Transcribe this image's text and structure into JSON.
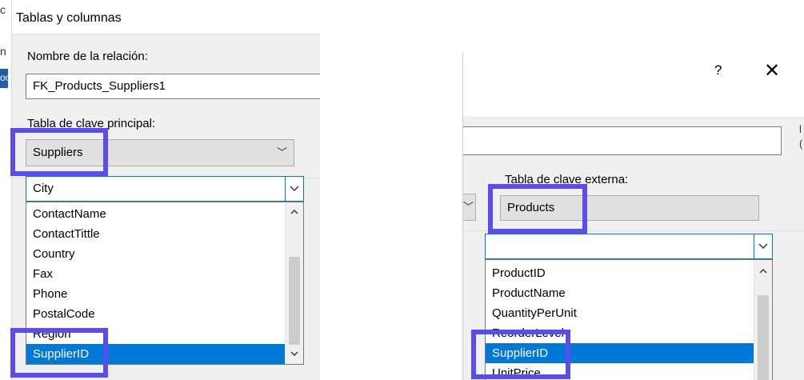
{
  "left_dialog": {
    "title": "Tablas y columnas",
    "edge_fragments": [
      "c",
      "n",
      "oc"
    ],
    "relation_label": "Nombre de la relación:",
    "relation_value": "FK_Products_Suppliers1",
    "primary_table_label": "Tabla de clave principal:",
    "primary_table_value": "Suppliers",
    "column_combo_value": "City",
    "column_list": [
      "ContactName",
      "ContactTittle",
      "Country",
      "Fax",
      "Phone",
      "PostalCode",
      "Region",
      "SupplierID"
    ],
    "selected_item": "SupplierID"
  },
  "right_dialog": {
    "help_glyph": "?",
    "close_glyph": "✕",
    "foreign_table_label": "Tabla de clave externa:",
    "foreign_table_value": "Products",
    "column_combo_value": "",
    "column_list": [
      "ProductID",
      "ProductName",
      "QuantityPerUnit",
      "ReorderLevel",
      "SupplierID",
      "UnitPrice"
    ],
    "selected_item": "SupplierID"
  },
  "colors": {
    "highlight": "#5a4df0",
    "selection": "#0078d7",
    "dialog_bg": "#f0f0f0"
  }
}
